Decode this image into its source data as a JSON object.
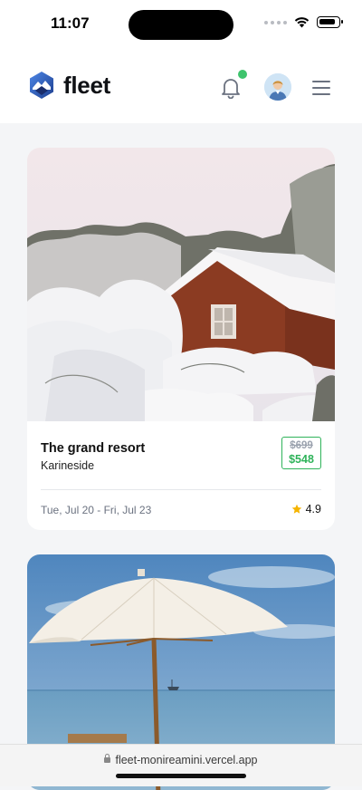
{
  "status": {
    "time": "11:07"
  },
  "header": {
    "brand": "fleet",
    "notification_badge_color": "#3ec46d"
  },
  "listings": [
    {
      "name": "The grand resort",
      "location": "Karineside",
      "old_price": "$699",
      "new_price": "$548",
      "dates": "Tue, Jul 20 - Fri, Jul 23",
      "rating": "4.9",
      "image": "snow-covered-cabin"
    },
    {
      "image": "beach-umbrella"
    }
  ],
  "browser": {
    "url": "fleet-monireamini.vercel.app"
  },
  "colors": {
    "accent_green": "#2fb35a",
    "star": "#f5b400"
  }
}
